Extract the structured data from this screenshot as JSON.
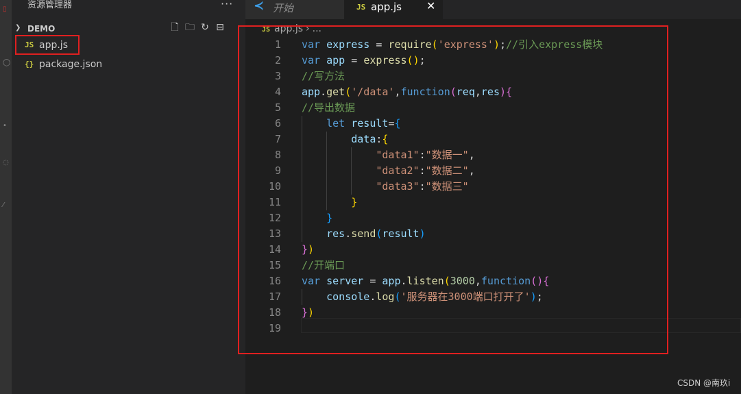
{
  "sidebar": {
    "title": "资源管理器",
    "more": "···",
    "section": "DEMO",
    "files": [
      {
        "icon": "JS",
        "name": "app.js"
      },
      {
        "icon": "{}",
        "name": "package.json"
      }
    ]
  },
  "tabs": [
    {
      "label": "开始"
    },
    {
      "label": "app.js",
      "icon": "JS"
    }
  ],
  "breadcrumb": {
    "icon": "JS",
    "file": "app.js",
    "rest": "..."
  },
  "code_lines": [
    "var express = require('express');//引入express模块",
    "var app = express();",
    "//写方法",
    "app.get('/data',function(req,res){",
    "//导出数据",
    "    let result={",
    "        data:{",
    "            \"data1\":\"数据一\",",
    "            \"data2\":\"数据二\",",
    "            \"data3\":\"数据三\"",
    "        }",
    "    }",
    "    res.send(result)",
    "})",
    "//开端口",
    "var server = app.listen(3000,function(){",
    "    console.log('服务器在3000端口打开了');",
    "})",
    ""
  ],
  "line_numbers": [
    "1",
    "2",
    "3",
    "4",
    "5",
    "6",
    "7",
    "8",
    "9",
    "10",
    "11",
    "12",
    "13",
    "14",
    "15",
    "16",
    "17",
    "18",
    "19"
  ],
  "watermark": "CSDN @南玖i",
  "colors": {
    "highlight_box": "#e02020",
    "editor_bg": "#1e1e1e",
    "sidebar_bg": "#252526"
  }
}
